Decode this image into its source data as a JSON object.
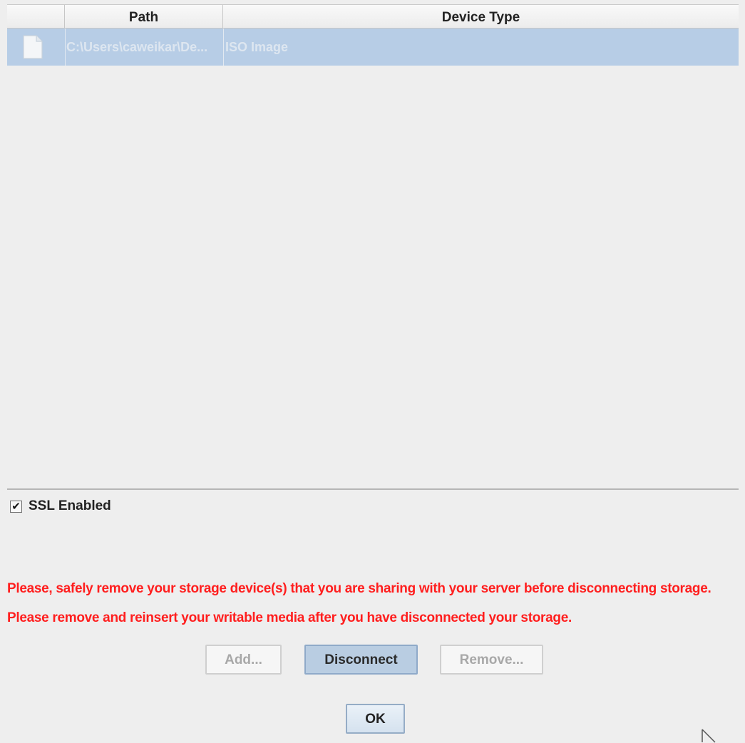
{
  "table": {
    "headers": {
      "icon": "",
      "path": "Path",
      "device_type": "Device Type"
    },
    "rows": [
      {
        "icon": "file-icon",
        "path": "C:\\Users\\caweikar\\De...",
        "device_type": "ISO Image"
      }
    ]
  },
  "ssl": {
    "label": "SSL Enabled",
    "checked": true
  },
  "warnings": {
    "line1": "Please, safely remove your storage device(s) that you are sharing with your server before disconnecting storage.",
    "line2": "Please remove and reinsert your writable media after you have disconnected your storage."
  },
  "buttons": {
    "add": "Add...",
    "disconnect": "Disconnect",
    "remove": "Remove...",
    "ok": "OK"
  },
  "colors": {
    "selection": "#b7cde6",
    "warning": "#ff1e1e",
    "background": "#eeeeee"
  }
}
